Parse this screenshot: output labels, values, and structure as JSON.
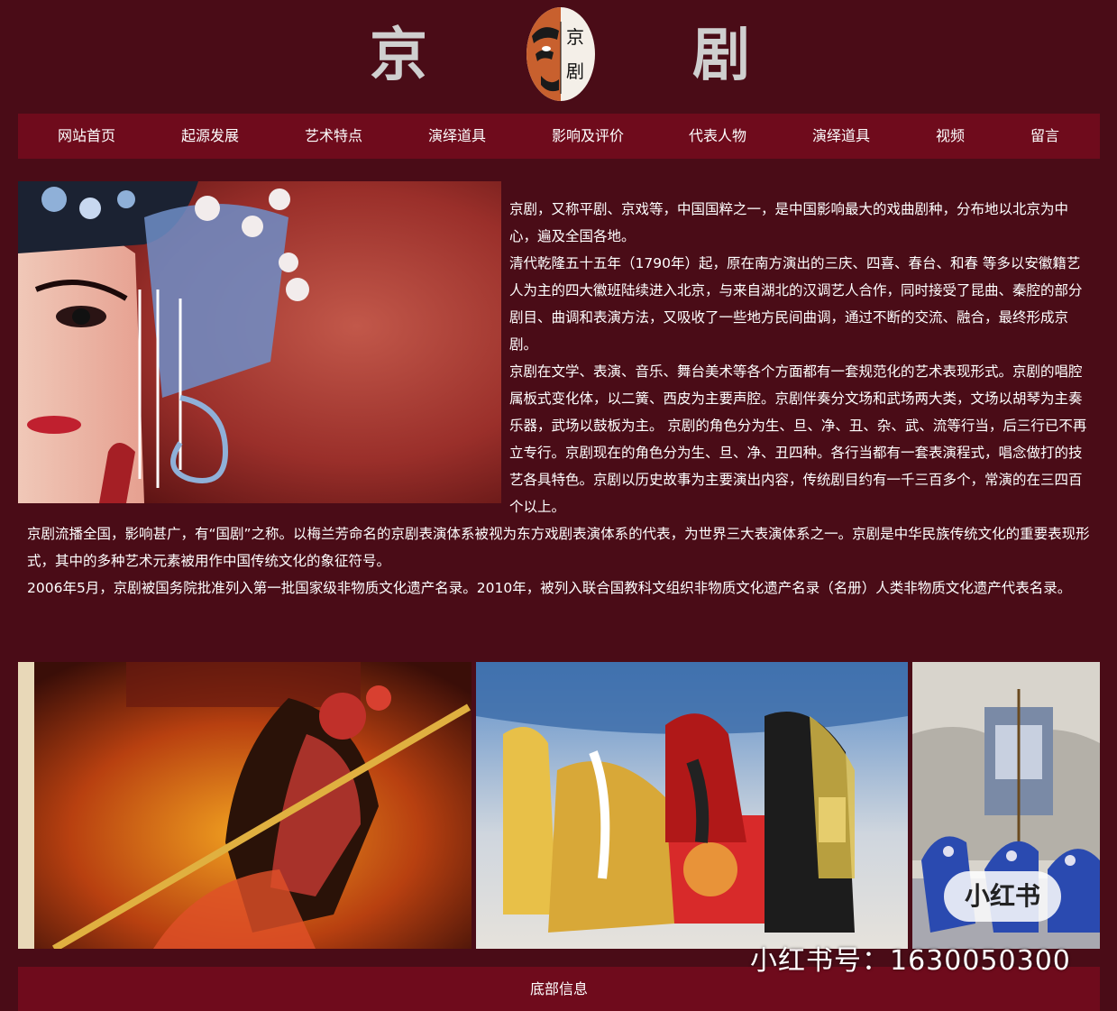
{
  "header": {
    "title_left": "京",
    "title_right": "剧",
    "logo_text_top": "京",
    "logo_text_bottom": "剧"
  },
  "nav": {
    "items": [
      {
        "label": "网站首页"
      },
      {
        "label": "起源发展"
      },
      {
        "label": "艺术特点"
      },
      {
        "label": "演绎道具"
      },
      {
        "label": "影响及评价"
      },
      {
        "label": "代表人物"
      },
      {
        "label": "演绎道具"
      },
      {
        "label": "视频"
      },
      {
        "label": "留言"
      }
    ]
  },
  "content": {
    "right_paragraphs": [
      "京剧，又称平剧、京戏等，中国国粹之一，是中国影响最大的戏曲剧种，分布地以北京为中心，遍及全国各地。",
      "清代乾隆五十五年（1790年）起，原在南方演出的三庆、四喜、春台、和春 等多以安徽籍艺人为主的四大徽班陆续进入北京，与来自湖北的汉调艺人合作，同时接受了昆曲、秦腔的部分剧目、曲调和表演方法，又吸收了一些地方民间曲调，通过不断的交流、融合，最终形成京剧。",
      "京剧在文学、表演、音乐、舞台美术等各个方面都有一套规范化的艺术表现形式。京剧的唱腔属板式变化体，以二簧、西皮为主要声腔。京剧伴奏分文场和武场两大类，文场以胡琴为主奏乐器，武场以鼓板为主。 京剧的角色分为生、旦、净、丑、杂、武、流等行当，后三行已不再立专行。京剧现在的角色分为生、旦、净、丑四种。各行当都有一套表演程式，唱念做打的技艺各具特色。京剧以历史故事为主要演出内容，传统剧目约有一千三百多个，常演的在三四百个以上。"
    ],
    "full_paragraphs": [
      "京剧流播全国，影响甚广，有“国剧”之称。以梅兰芳命名的京剧表演体系被视为东方戏剧表演体系的代表，为世界三大表演体系之一。京剧是中华民族传统文化的重要表现形式，其中的多种艺术元素被用作中国传统文化的象征符号。",
      "2006年5月，京剧被国务院批准列入第一批国家级非物质文化遗产名录。2010年，被列入联合国教科文组织非物质文化遗产名录（名册）人类非物质文化遗产代表名录。"
    ]
  },
  "footer": {
    "label": "底部信息"
  },
  "watermark": {
    "badge": "小红书",
    "account": "小红书号：1630050300"
  },
  "colors": {
    "background": "#4a0c17",
    "bar": "#6f0b1c",
    "title": "#cfcfcf"
  }
}
